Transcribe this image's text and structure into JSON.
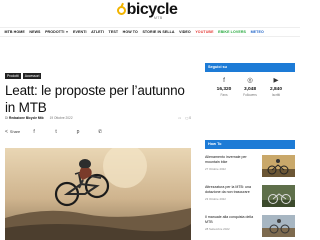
{
  "header": {
    "logo_text": "bicycle",
    "logo_sub": "MTB"
  },
  "nav": {
    "items": [
      {
        "label": "MTB HOME",
        "style": "normal"
      },
      {
        "label": "NEWS",
        "style": "normal"
      },
      {
        "label": "PRODOTTI",
        "style": "normal",
        "dropdown": true
      },
      {
        "label": "EVENTI",
        "style": "normal"
      },
      {
        "label": "ATLETI",
        "style": "normal"
      },
      {
        "label": "TEST",
        "style": "normal"
      },
      {
        "label": "HOW TO",
        "style": "normal"
      },
      {
        "label": "STORIE IN SELLA",
        "style": "normal"
      },
      {
        "label": "VIDEO",
        "style": "normal"
      },
      {
        "label": "YOUTUBE",
        "style": "yt"
      },
      {
        "label": "EBIKE LOVERS",
        "style": "green"
      },
      {
        "label": "METEO",
        "style": "blue"
      }
    ]
  },
  "article": {
    "crumbs": [
      "Prodotti",
      "Accessori"
    ],
    "title": "Leatt: le proposte per l’autunno in MTB",
    "meta": {
      "by": "Di",
      "author": "Redazione Bicycle Mtb",
      "date": "19 Ottobre 2022",
      "comments": "0"
    },
    "share_label": "Share"
  },
  "sidebar": {
    "follow_title": "Seguici su",
    "counters": [
      {
        "icon": "facebook-icon",
        "glyph": "f",
        "value": "16,320",
        "label": "Fans"
      },
      {
        "icon": "instagram-icon",
        "glyph": "◎",
        "value": "3,048",
        "label": "Followers"
      },
      {
        "icon": "youtube-icon",
        "glyph": "▶",
        "value": "2,840",
        "label": "Iscritti"
      }
    ],
    "howto_title": "How To",
    "items": [
      {
        "title": "Allenamento invernale per mountain bike",
        "date": "27 Ottobre 2022"
      },
      {
        "title": "Attrezzatura per la MTB: una dotazione da non trascurare",
        "date": "23 Ottobre 2022"
      },
      {
        "title": "Il manuale alla conquista della MTB",
        "date": "28 Settembre 2022"
      }
    ]
  },
  "colors": {
    "accent": "#1d7bd6",
    "youtube": "#e53935",
    "green": "#22a83a",
    "logo": "#f2b400"
  }
}
